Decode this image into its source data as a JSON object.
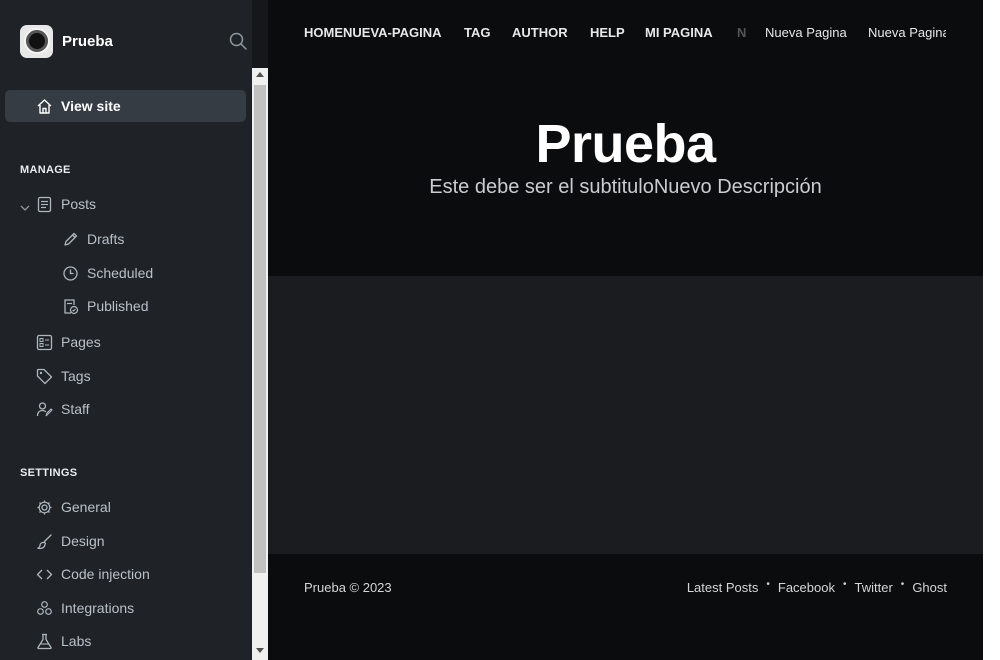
{
  "sidebar": {
    "site_name": "Prueba",
    "view_site_label": "View site",
    "manage_title": "MANAGE",
    "manage_items": [
      {
        "label": "Posts",
        "icon": "posts-icon"
      },
      {
        "label": "Drafts",
        "icon": "pencil-icon"
      },
      {
        "label": "Scheduled",
        "icon": "clock-icon"
      },
      {
        "label": "Published",
        "icon": "published-icon"
      },
      {
        "label": "Pages",
        "icon": "pages-icon"
      },
      {
        "label": "Tags",
        "icon": "tag-icon"
      },
      {
        "label": "Staff",
        "icon": "staff-icon"
      }
    ],
    "settings_title": "SETTINGS",
    "settings_items": [
      {
        "label": "General",
        "icon": "gear-icon"
      },
      {
        "label": "Design",
        "icon": "brush-icon"
      },
      {
        "label": "Code injection",
        "icon": "code-icon"
      },
      {
        "label": "Integrations",
        "icon": "integrations-icon"
      },
      {
        "label": "Labs",
        "icon": "flask-icon"
      }
    ]
  },
  "preview": {
    "nav_links": [
      "HOMENUEVA-PAGINA",
      "TAG",
      "AUTHOR",
      "HELP",
      "MI PAGINA",
      "N",
      "Nueva Pagina",
      "Nueva Pagina"
    ],
    "title": "Prueba",
    "subtitle": "Este debe ser el subtituloNuevo Descripción",
    "footer_copy": "Prueba © 2023",
    "footer_links": [
      "Latest Posts",
      "Facebook",
      "Twitter",
      "Ghost"
    ],
    "footer_separator": "•"
  },
  "colors": {
    "sidebar_bg": "#1f2328",
    "active_item_bg": "#353c44",
    "preview_bg": "#0b0c0e",
    "content_bg": "#1b1c1f"
  }
}
